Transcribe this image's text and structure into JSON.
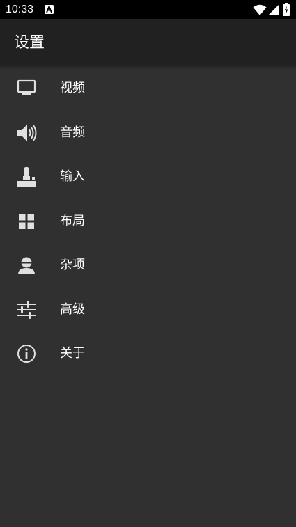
{
  "status_bar": {
    "time": "10:33",
    "icons": [
      "a-notification-icon",
      "wifi-icon",
      "signal-icon",
      "battery-charging-icon"
    ]
  },
  "app_bar": {
    "title": "设置"
  },
  "menu": {
    "items": [
      {
        "label": "视频",
        "icon": "monitor-icon"
      },
      {
        "label": "音频",
        "icon": "speaker-icon"
      },
      {
        "label": "输入",
        "icon": "joystick-icon"
      },
      {
        "label": "布局",
        "icon": "grid-icon"
      },
      {
        "label": "杂项",
        "icon": "person-icon"
      },
      {
        "label": "高级",
        "icon": "sliders-icon"
      },
      {
        "label": "关于",
        "icon": "info-icon"
      }
    ]
  },
  "colors": {
    "background": "#303030",
    "app_bar": "#212121",
    "status_bar": "#000000",
    "icon": "#e0e0e0",
    "text": "#ffffff"
  }
}
